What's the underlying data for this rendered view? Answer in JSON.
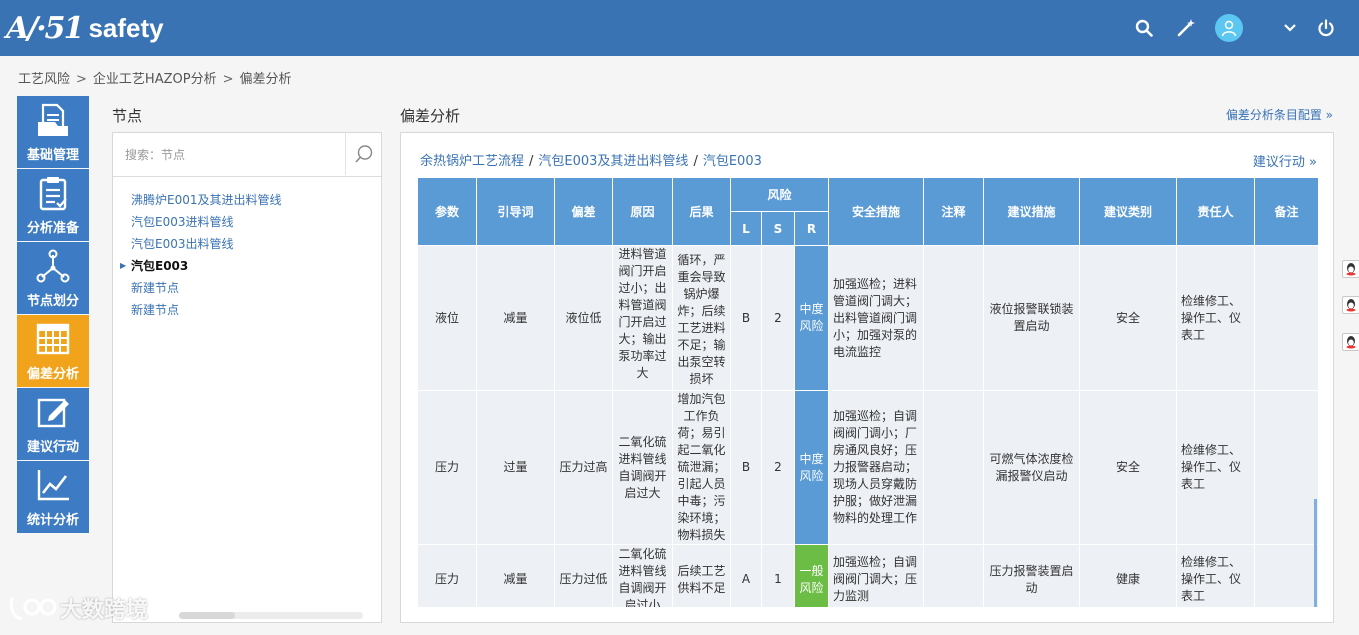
{
  "header": {
    "logo_mark": "A/·51",
    "logo_text": "safety",
    "icons": [
      "search-icon",
      "magic-wand-icon",
      "user-avatar-icon",
      "chevron-down-icon",
      "power-icon"
    ]
  },
  "breadcrumb": [
    "工艺风险",
    "企业工艺HAZOP分析",
    "偏差分析"
  ],
  "breadcrumb_sep": ">",
  "nav": [
    {
      "label": "基础管理",
      "icon": "folder-document-icon",
      "active": false
    },
    {
      "label": "分析准备",
      "icon": "clipboard-list-icon",
      "active": false
    },
    {
      "label": "节点划分",
      "icon": "node-network-icon",
      "active": false
    },
    {
      "label": "偏差分析",
      "icon": "table-grid-icon",
      "active": true
    },
    {
      "label": "建议行动",
      "icon": "edit-note-icon",
      "active": false
    },
    {
      "label": "统计分析",
      "icon": "line-chart-icon",
      "active": false
    }
  ],
  "nodes": {
    "title": "节点",
    "search_placeholder": "搜索：节点",
    "items": [
      {
        "label": "沸腾炉E001及其进出料管线",
        "active": false
      },
      {
        "label": "汽包E003进料管线",
        "active": false
      },
      {
        "label": "汽包E003出料管线",
        "active": false
      },
      {
        "label": "汽包E003",
        "active": true
      },
      {
        "label": "新建节点",
        "active": false
      },
      {
        "label": "新建节点",
        "active": false
      }
    ]
  },
  "deviation": {
    "title": "偏差分析",
    "config_link": "偏差分析条目配置 »",
    "path": [
      "余热锅炉工艺流程",
      "汽包E003及其进出料管线",
      "汽包E003"
    ],
    "path_sep": "/",
    "suggest_link": "建议行动 »",
    "columns": {
      "param": "参数",
      "guide": "引导词",
      "deviation": "偏差",
      "cause": "原因",
      "consequence": "后果",
      "risk": "风险",
      "L": "L",
      "S": "S",
      "R": "R",
      "safety": "安全措施",
      "note": "注释",
      "suggestion": "建议措施",
      "category": "建议类别",
      "owner": "责任人",
      "remark": "备注"
    },
    "rows": [
      {
        "param": "液位",
        "guide": "减量",
        "deviation": "液位低",
        "cause": "进料管道阀门开启过小；出料管道阀门开启过大；输出泵功率过大",
        "consequence": "循环，严重会导致锅炉爆炸；后续工艺进料不足；输出泵空转损坏",
        "L": "B",
        "S": "2",
        "R": "中度风险",
        "R_level": "mid",
        "safety": "加强巡检；进料管道阀门调大；出料管道阀门调小；加强对泵的电流监控",
        "note": "",
        "suggestion": "液位报警联锁装置启动",
        "category": "安全",
        "owner": "检维修工、操作工、仪表工",
        "remark": ""
      },
      {
        "param": "压力",
        "guide": "过量",
        "deviation": "压力过高",
        "cause": "二氧化硫进料管线自调阀开启过大",
        "consequence": "增加汽包工作负荷；易引起二氧化硫泄漏；引起人员中毒；污染环境；物料损失",
        "L": "B",
        "S": "2",
        "R": "中度风险",
        "R_level": "mid",
        "safety": "加强巡检；自调阀阀门调小；厂房通风良好；压力报警器启动；现场人员穿戴防护服；做好泄漏物料的处理工作",
        "note": "",
        "suggestion": "可燃气体浓度检漏报警仪启动",
        "category": "安全",
        "owner": "检维修工、操作工、仪表工",
        "remark": ""
      },
      {
        "param": "压力",
        "guide": "减量",
        "deviation": "压力过低",
        "cause": "二氧化硫进料管线自调阀开启过小",
        "consequence": "后续工艺供料不足",
        "L": "A",
        "S": "1",
        "R": "一般风险",
        "R_level": "low",
        "safety": "加强巡检；自调阀阀门调大；压力监测",
        "note": "",
        "suggestion": "压力报警装置启动",
        "category": "健康",
        "owner": "检维修工、操作工、仪表工",
        "remark": ""
      }
    ]
  },
  "side_icons": [
    "qq-chat-icon",
    "qq-chat-icon",
    "qq-chat-icon"
  ],
  "watermark": "大数跨境",
  "colors": {
    "header": "#3a73b4",
    "nav": "#3d7cc4",
    "nav_active": "#f2a31c",
    "table_header": "#5b9bd5",
    "risk_mid": "#5b9bd5",
    "risk_low": "#6cbd45"
  }
}
